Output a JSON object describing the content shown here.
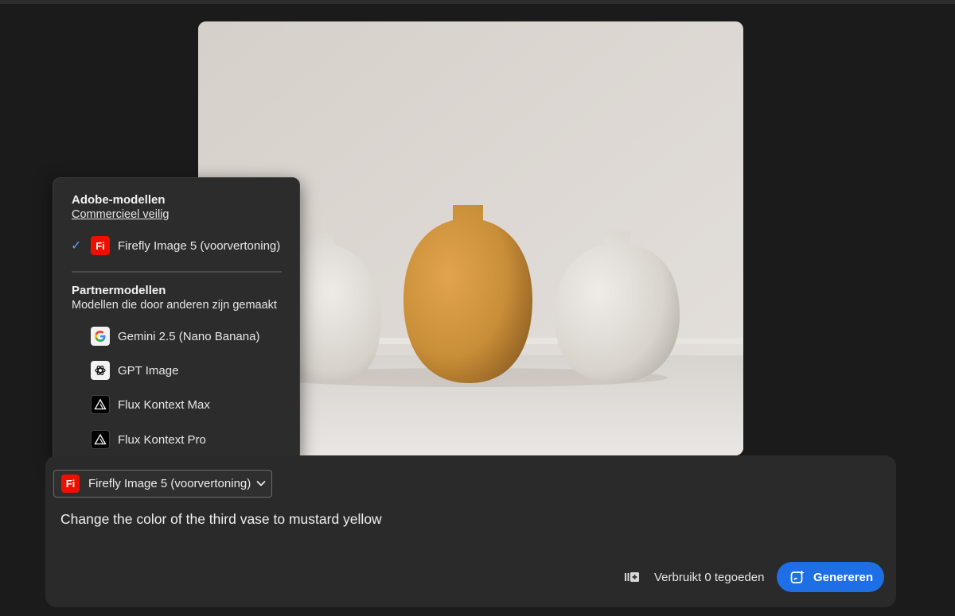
{
  "menu": {
    "adobe_heading": "Adobe-modellen",
    "adobe_sub": "Commercieel veilig",
    "selected_check": "✓",
    "adobe_items": [
      {
        "label": "Firefly Image 5 (voorvertoning)",
        "icon": "firefly-icon",
        "icon_text": "Fi",
        "selected": true
      }
    ],
    "partner_heading": "Partnermodellen",
    "partner_sub": "Modellen die door anderen zijn gemaakt",
    "partner_items": [
      {
        "label": "Gemini 2.5 (Nano Banana)",
        "icon": "google-icon"
      },
      {
        "label": "GPT Image",
        "icon": "openai-icon"
      },
      {
        "label": "Flux Kontext Max",
        "icon": "flux-icon"
      },
      {
        "label": "Flux Kontext Pro",
        "icon": "flux-icon"
      }
    ]
  },
  "prompt": {
    "model_select_label": "Firefly Image 5 (voorvertoning)",
    "model_icon_text": "Fi",
    "text": "Change the color of the third vase to mustard yellow",
    "credits": "Verbruikt 0 tegoeden",
    "generate_label": "Genereren"
  },
  "colors": {
    "accent": "#1e6fe6",
    "firefly_red": "#eb1000",
    "check_blue": "#5aa0ff"
  }
}
